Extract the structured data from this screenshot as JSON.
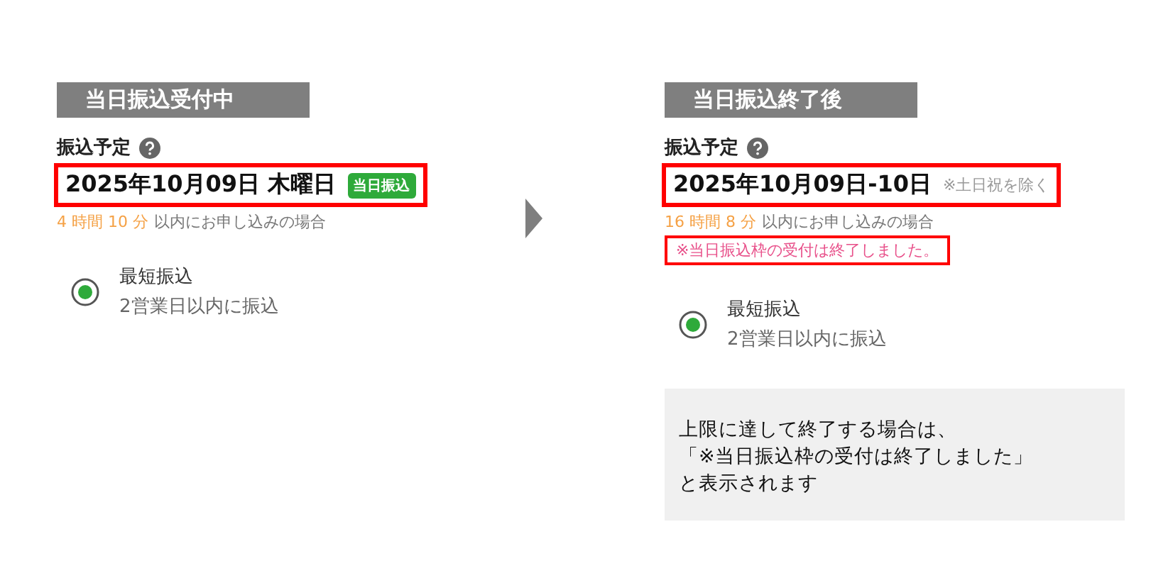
{
  "panels": [
    {
      "header": "当日振込受付中",
      "label": "振込予定",
      "date": "2025年10月09日 木曜日",
      "badge": "当日振込",
      "deadline_time": "4 時間 10 分",
      "deadline_text": "以内にお申し込みの場合",
      "option": {
        "title": "最短振込",
        "sub": "2営業日以内に振込",
        "selected": true
      }
    },
    {
      "header": "当日振込終了後",
      "label": "振込予定",
      "date": "2025年10月09日-10日",
      "date_note": "※土日祝を除く",
      "deadline_time": "16 時間 8 分",
      "deadline_text": "以内にお申し込みの場合",
      "notice": "※当日振込枠の受付は終了しました。",
      "option": {
        "title": "最短振込",
        "sub": "2営業日以内に振込",
        "selected": true
      },
      "callout": [
        "上限に達して終了する場合は、",
        "「※当日振込枠の受付は終了しました」",
        "と表示されます"
      ]
    }
  ]
}
